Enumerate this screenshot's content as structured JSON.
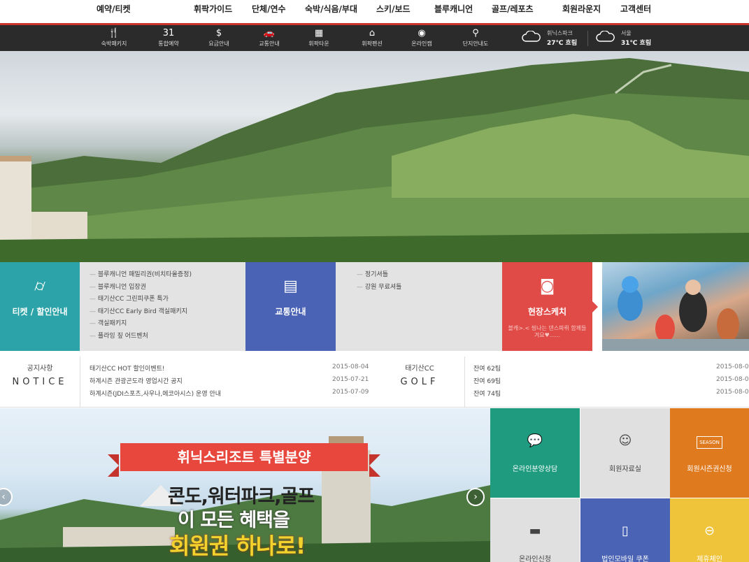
{
  "topnav": {
    "items": [
      "예약/티켓",
      "휘팍가이드",
      "단체/연수",
      "숙박/식음/부대",
      "스키/보드",
      "블루캐니언",
      "골프/레포츠",
      "회원라운지",
      "고객센터"
    ]
  },
  "subnav": {
    "items": [
      {
        "label": "숙박패키지",
        "icon": "dining-icon",
        "glyph": "🍴"
      },
      {
        "label": "통합예약",
        "icon": "calendar-icon",
        "glyph": "31"
      },
      {
        "label": "요금안내",
        "icon": "price-icon",
        "glyph": "$"
      },
      {
        "label": "교통안내",
        "icon": "car-icon",
        "glyph": "🚗"
      },
      {
        "label": "휘팍타운",
        "icon": "town-icon",
        "glyph": "▦"
      },
      {
        "label": "휘팍펜션",
        "icon": "house-icon",
        "glyph": "⌂"
      },
      {
        "label": "온라인캠",
        "icon": "camera-icon",
        "glyph": "◉"
      },
      {
        "label": "단지안내도",
        "icon": "map-pin-icon",
        "glyph": "⚲"
      }
    ],
    "weather": [
      {
        "place": "휘닉스파크",
        "value": "27℃ 흐림"
      },
      {
        "place": "서울",
        "value": "31℃ 흐림"
      }
    ]
  },
  "quick": {
    "ticket": {
      "label": "티켓 / 할인안내",
      "color": "#2ba3a8",
      "icon": "tag-icon",
      "glyph": "⌭"
    },
    "ticket_list": [
      "블루캐니언 패밀리권(비치타올증정)",
      "블루캐니언 입장권",
      "태기산CC 그린피쿠폰 특가",
      "태기산CC Early Bird 객실패키지",
      "객실패키지",
      "플라잉 짚 어드벤처"
    ],
    "traffic": {
      "label": "교통안내",
      "color": "#4a63b5",
      "icon": "bus-icon",
      "glyph": "▤"
    },
    "traffic_list": [
      "정기셔틀",
      "강원 무료셔틀"
    ],
    "sketch": {
      "label": "현장스케치",
      "color": "#e04b47",
      "icon": "camera-icon",
      "glyph": "◙",
      "caption": "블캐>.< 씽나는 댄스파뤼 함께들겨요♥......"
    }
  },
  "notice": {
    "left": {
      "ko": "공지사항",
      "en": "NOTICE"
    },
    "left_rows": [
      {
        "title": "태기산CC HOT 할인이벤트!",
        "date": "2015-08-04"
      },
      {
        "title": "하계시즌 관광곤도라 영업시간 공지",
        "date": "2015-07-21"
      },
      {
        "title": "하계시즌(JDI스포츠,사우나,에코아시스) 운영 안내",
        "date": "2015-07-09"
      }
    ],
    "right": {
      "ko": "태기산CC",
      "en": "GOLF"
    },
    "right_rows": [
      {
        "title": "잔여 62팀",
        "date": "2015-08-0"
      },
      {
        "title": "잔여 69팀",
        "date": "2015-08-0"
      },
      {
        "title": "잔여 74팀",
        "date": "2015-08-0"
      }
    ]
  },
  "promo": {
    "ribbon": "휘닉스리조트 특별분양",
    "line1": "콘도,워터파크,골프",
    "line2": "이 모든 혜택을",
    "line3": "회원권 하나로!",
    "prev": "‹",
    "next": "›"
  },
  "grid": [
    {
      "label": "온라인분양상담",
      "color": "#1f9b7f",
      "icon": "chat-icon",
      "glyph": "💬",
      "textColor": "#ffffff"
    },
    {
      "label": "회원자료실",
      "color": "#e0e0e0",
      "icon": "smile-icon",
      "glyph": "☺",
      "textColor": "#444444"
    },
    {
      "label": "회원시즌권신청",
      "color": "#e07a1f",
      "icon": "season-ticket-icon",
      "glyph": "SEASON",
      "textColor": "#ffffff"
    },
    {
      "label": "온라인신청",
      "color": "#e0e0e0",
      "icon": "card-icon",
      "glyph": "▬",
      "textColor": "#444444"
    },
    {
      "label": "법인모바일 쿠폰",
      "color": "#4a63b5",
      "icon": "mobile-icon",
      "glyph": "▯",
      "textColor": "#ffffff"
    },
    {
      "label": "제휴체인",
      "color": "#f0c43a",
      "icon": "chain-icon",
      "glyph": "⊖",
      "textColor": "#ffffff"
    }
  ]
}
